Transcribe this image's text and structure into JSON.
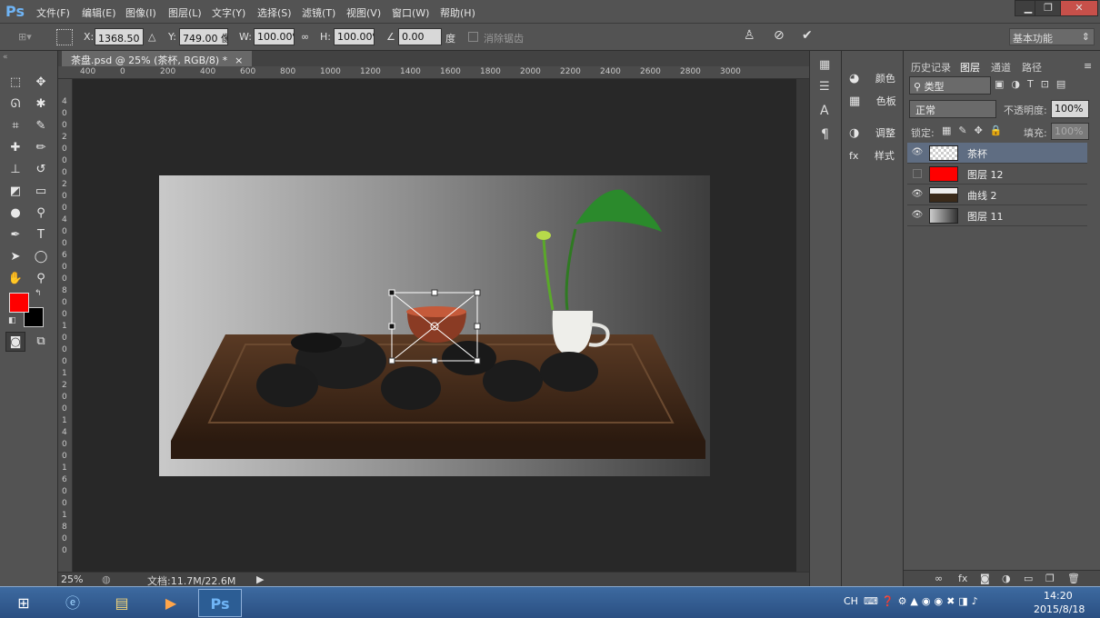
{
  "app": {
    "logo": "Ps"
  },
  "menu": [
    "文件(F)",
    "编辑(E)",
    "图像(I)",
    "图层(L)",
    "文字(Y)",
    "选择(S)",
    "滤镜(T)",
    "视图(V)",
    "窗口(W)",
    "帮助(H)"
  ],
  "window_buttons": [
    "▁",
    "❐",
    "✕"
  ],
  "options": {
    "x_label": "X:",
    "x_value": "1368.50 像",
    "y_label": "Y:",
    "y_value": "749.00 像",
    "w_label": "W:",
    "w_value": "100.00%",
    "h_label": "H:",
    "h_value": "100.00%",
    "angle_value": "0.00",
    "angle_unit": "度",
    "antialias_label": "消除锯齿",
    "workspace": "基本功能"
  },
  "document": {
    "tab_title": "茶盘.psd @ 25% (茶杯, RGB/8) *",
    "zoom": "25%",
    "doc_info": "文档:11.7M/22.6M"
  },
  "ruler_h": [
    "400",
    "0",
    "200",
    "400",
    "600",
    "800",
    "1000",
    "1200",
    "1400",
    "1600",
    "1800",
    "2000",
    "2200",
    "2400",
    "2600",
    "2800",
    "3000"
  ],
  "ruler_v": [
    "4",
    "0",
    "0",
    "2",
    "0",
    "0",
    "0",
    "2",
    "0",
    "0",
    "4",
    "0",
    "0",
    "6",
    "0",
    "0",
    "8",
    "0",
    "0",
    "1",
    "0",
    "0",
    "0",
    "1",
    "2",
    "0",
    "0",
    "1",
    "4",
    "0",
    "0",
    "1",
    "6",
    "0",
    "0",
    "1",
    "8",
    "0",
    "0"
  ],
  "mid_panel": [
    {
      "icon": "palette-icon",
      "label": "颜色"
    },
    {
      "icon": "swatches-icon",
      "label": "色板"
    },
    {
      "icon": "adjustments-icon",
      "label": "调整"
    },
    {
      "icon": "styles-icon",
      "label": "样式"
    }
  ],
  "layers_panel": {
    "tabs": [
      "历史记录",
      "图层",
      "通道",
      "路径"
    ],
    "active_tab": "图层",
    "filter_label": "类型",
    "blend_mode": "正常",
    "opacity_label": "不透明度:",
    "opacity_value": "100%",
    "lock_label": "锁定:",
    "fill_label": "填充:",
    "fill_value": "100%",
    "layers": [
      {
        "name": "茶杯",
        "visible": true,
        "selected": true,
        "thumb": "cup"
      },
      {
        "name": "图层 12",
        "visible": false,
        "selected": false,
        "thumb": "red"
      },
      {
        "name": "曲线 2",
        "visible": true,
        "selected": false,
        "thumb": "curves"
      },
      {
        "name": "图层 11",
        "visible": true,
        "selected": false,
        "thumb": "gradient"
      }
    ],
    "footer_icons": [
      "link-icon",
      "fx-icon",
      "mask-icon",
      "adjustment-icon",
      "folder-icon",
      "new-layer-icon",
      "trash-icon"
    ]
  },
  "colors": {
    "foreground": "#ff0000",
    "background": "#000000",
    "selected_layer": "#5f6d82",
    "accent": "#6fb4f5"
  },
  "taskbar": {
    "lang": "CH",
    "time": "14:20",
    "date": "2015/8/18"
  }
}
